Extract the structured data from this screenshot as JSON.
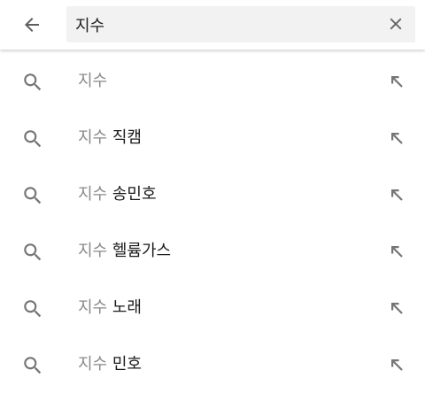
{
  "search": {
    "query": "지수",
    "back_icon": "arrow-left-icon",
    "clear_icon": "close-icon"
  },
  "colors": {
    "query_gray": "#8a8a8a",
    "suggest_dark": "#1a1a1a",
    "icon_gray": "#757575"
  },
  "suggestions": [
    {
      "query_part": "지수",
      "rest": ""
    },
    {
      "query_part": "지수",
      "rest": " 직캠"
    },
    {
      "query_part": "지수",
      "rest": " 송민호"
    },
    {
      "query_part": "지수",
      "rest": " 헬륨가스"
    },
    {
      "query_part": "지수",
      "rest": " 노래"
    },
    {
      "query_part": "지수",
      "rest": " 민호"
    }
  ]
}
